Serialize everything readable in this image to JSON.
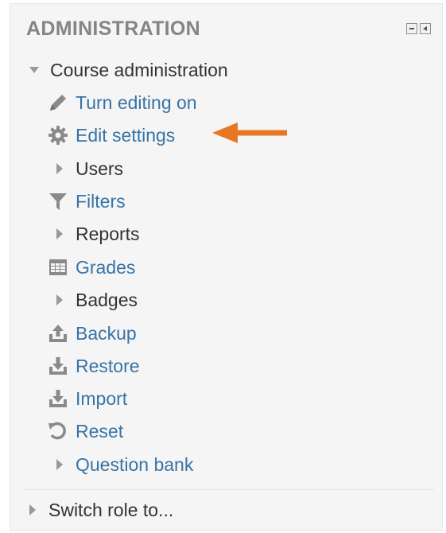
{
  "block": {
    "title": "ADMINISTRATION",
    "controls": [
      "hide-icon",
      "dock-icon"
    ]
  },
  "course_admin": {
    "label": "Course administration",
    "items": [
      {
        "label": "Turn editing on",
        "icon": "pencil-icon",
        "type": "link"
      },
      {
        "label": "Edit settings",
        "icon": "gear-icon",
        "type": "link"
      },
      {
        "label": "Users",
        "icon": "caret-right-icon",
        "type": "branch"
      },
      {
        "label": "Filters",
        "icon": "filter-icon",
        "type": "link"
      },
      {
        "label": "Reports",
        "icon": "caret-right-icon",
        "type": "branch"
      },
      {
        "label": "Grades",
        "icon": "table-icon",
        "type": "link"
      },
      {
        "label": "Badges",
        "icon": "caret-right-icon",
        "type": "branch"
      },
      {
        "label": "Backup",
        "icon": "upload-icon",
        "type": "link"
      },
      {
        "label": "Restore",
        "icon": "download-icon",
        "type": "link"
      },
      {
        "label": "Import",
        "icon": "download-icon",
        "type": "link"
      },
      {
        "label": "Reset",
        "icon": "reset-icon",
        "type": "link"
      },
      {
        "label": "Question bank",
        "icon": "caret-right-icon",
        "type": "branch-link"
      }
    ]
  },
  "switch_role": {
    "label": "Switch role to..."
  },
  "colors": {
    "link": "#3873a6",
    "text": "#333333",
    "title": "#858585",
    "arrow": "#e87722"
  }
}
